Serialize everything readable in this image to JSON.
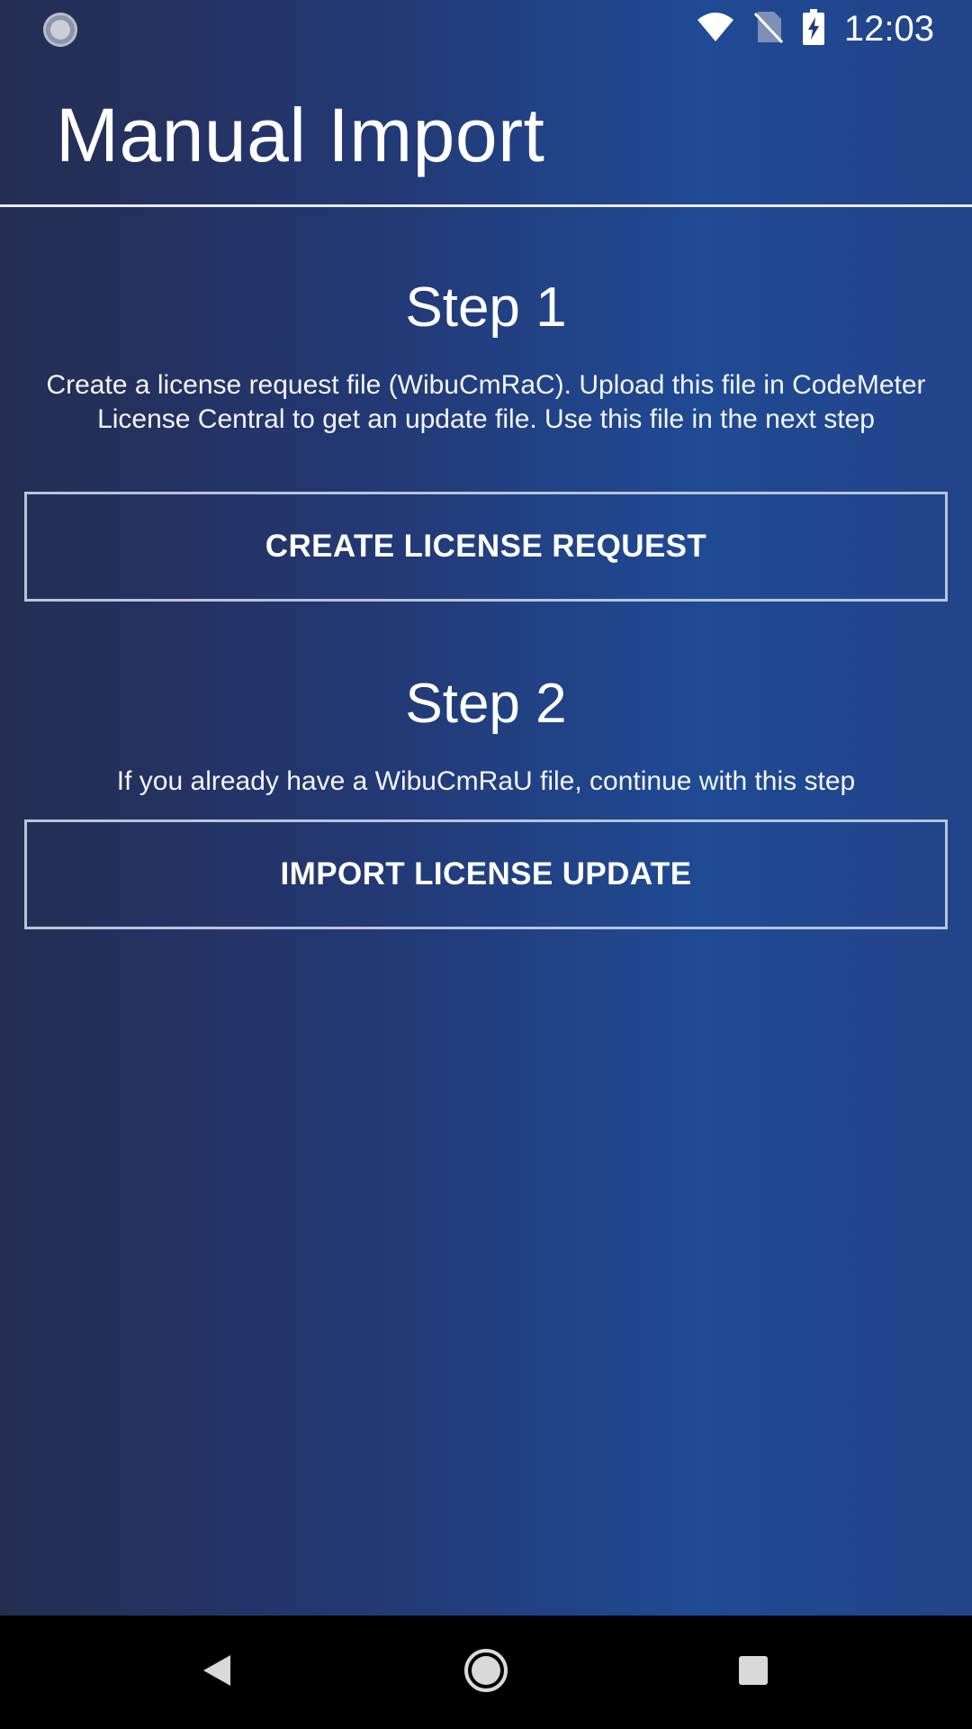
{
  "status_bar": {
    "time": "12:03",
    "icons": [
      "sync-icon",
      "wifi-icon",
      "no-sim-icon",
      "battery-charging-icon"
    ]
  },
  "header": {
    "title": "Manual Import"
  },
  "step1": {
    "heading": "Step 1",
    "description": "Create a license request file (WibuCmRaC). Upload this file in CodeMeter License Central to get an update file. Use this file in the next step",
    "button_label": "CREATE LICENSE REQUEST"
  },
  "step2": {
    "heading": "Step 2",
    "description": "If you already have a WibuCmRaU file, continue with this step",
    "button_label": "IMPORT LICENSE UPDATE"
  },
  "nav_bar": {
    "icons": [
      "back-icon",
      "home-icon",
      "recents-icon"
    ]
  },
  "colors": {
    "background_gradient": [
      "#252d52",
      "#233771",
      "#1f4a94"
    ],
    "button_border": "#b9c3da",
    "nav_bar": "#000000"
  }
}
